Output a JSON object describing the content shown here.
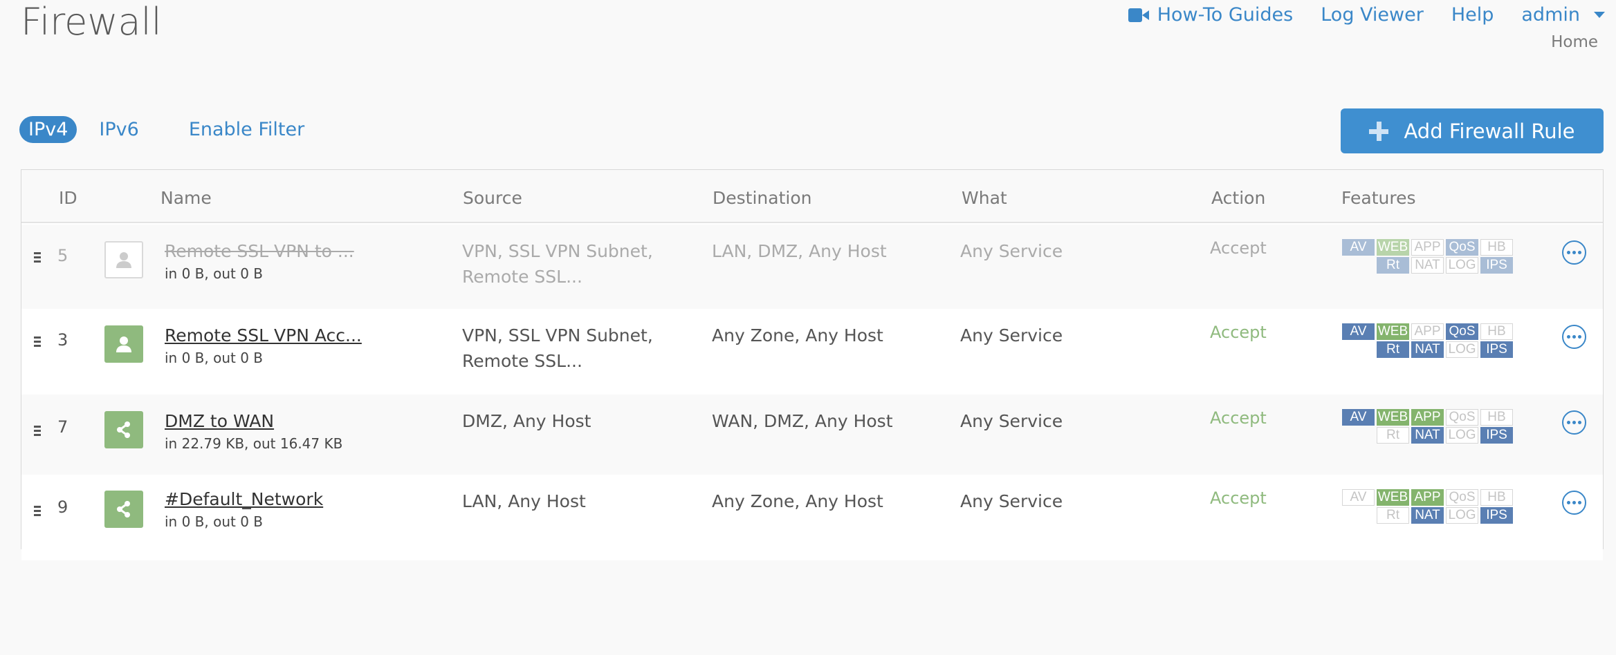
{
  "page": {
    "title": "Firewall",
    "breadcrumb": "Home"
  },
  "topnav": {
    "guides": "How-To Guides",
    "log_viewer": "Log Viewer",
    "help": "Help",
    "user": "admin"
  },
  "tabs": [
    {
      "label": "IPv4",
      "active": true
    },
    {
      "label": "IPv6",
      "active": false
    },
    {
      "label": "Enable Filter",
      "active": false
    }
  ],
  "add_button": {
    "label": "Add Firewall Rule"
  },
  "columns": [
    "ID",
    "Name",
    "Source",
    "Destination",
    "What",
    "Action",
    "Features"
  ],
  "rows": [
    {
      "id": "5",
      "name": "Remote SSL VPN to ...",
      "traffic": "in 0 B, out 0 B",
      "source_line1": "VPN, SSL VPN Subnet,",
      "source_line2": "Remote SSL...",
      "destination": "LAN, DMZ, Any Host",
      "what": "Any Service",
      "action": "Accept",
      "enabled": false,
      "icon": "user-icon",
      "features": {
        "AV": "on",
        "WEB": "on-green",
        "APP": "off",
        "QoS": "on",
        "HB": "off",
        "Rt": "on",
        "NAT": "off",
        "LOG": "off",
        "IPS": "on"
      }
    },
    {
      "id": "3",
      "name": "Remote SSL VPN Acc...",
      "traffic": "in 0 B, out 0 B",
      "source_line1": "VPN, SSL VPN Subnet,",
      "source_line2": "Remote SSL...",
      "destination": "Any Zone, Any Host",
      "what": "Any Service",
      "action": "Accept",
      "enabled": true,
      "icon": "user-icon",
      "features": {
        "AV": "on",
        "WEB": "on-green",
        "APP": "off",
        "QoS": "on",
        "HB": "off",
        "Rt": "on",
        "NAT": "on",
        "LOG": "off",
        "IPS": "on"
      }
    },
    {
      "id": "7",
      "name": "DMZ to WAN",
      "traffic": "in 22.79 KB, out 16.47 KB",
      "source_line1": "DMZ, Any Host",
      "source_line2": "",
      "destination": "WAN, DMZ, Any Host",
      "what": "Any Service",
      "action": "Accept",
      "enabled": true,
      "icon": "network-share-icon",
      "features": {
        "AV": "on",
        "WEB": "on-green",
        "APP": "on-green",
        "QoS": "off",
        "HB": "off",
        "Rt": "off",
        "NAT": "on",
        "LOG": "off",
        "IPS": "on"
      }
    },
    {
      "id": "9",
      "name": "#Default_Network",
      "traffic": "in 0 B, out 0 B",
      "source_line1": "LAN, Any Host",
      "source_line2": "",
      "destination": "Any Zone, Any Host",
      "what": "Any Service",
      "action": "Accept",
      "enabled": true,
      "icon": "network-share-icon",
      "features": {
        "AV": "off",
        "WEB": "on-green",
        "APP": "on-green",
        "QoS": "off",
        "HB": "off",
        "Rt": "off",
        "NAT": "on",
        "LOG": "off",
        "IPS": "on"
      }
    }
  ],
  "colors": {
    "accent": "#3a87c8",
    "accept_green": "#8fba7e",
    "badge_blue": "#5a7fb3",
    "badge_green": "#84b46d"
  }
}
